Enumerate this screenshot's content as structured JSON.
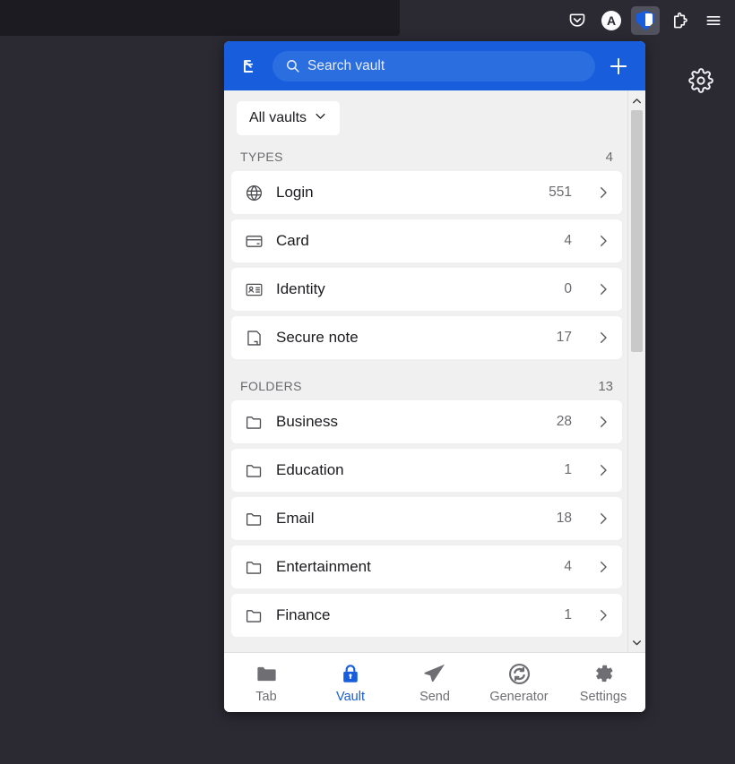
{
  "browser": {
    "toolbar_icons": [
      {
        "name": "pocket-icon",
        "label": "Pocket"
      },
      {
        "name": "account-avatar",
        "label": "A"
      },
      {
        "name": "bitwarden-extension-icon",
        "label": "Bitwarden"
      },
      {
        "name": "extensions-icon",
        "label": "Extensions"
      },
      {
        "name": "app-menu-icon",
        "label": "Open application menu"
      }
    ],
    "page_gear_label": "Settings"
  },
  "popup": {
    "header": {
      "popout_label": "Pop out to new window",
      "search_placeholder": "Search vault",
      "search_value": "",
      "add_label": "Add item"
    },
    "vault_filter": {
      "label": "All vaults"
    },
    "sections": [
      {
        "title": "TYPES",
        "count": "4",
        "rows": [
          {
            "icon": "globe-icon",
            "label": "Login",
            "count": "551"
          },
          {
            "icon": "credit-card-icon",
            "label": "Card",
            "count": "4"
          },
          {
            "icon": "id-card-icon",
            "label": "Identity",
            "count": "0"
          },
          {
            "icon": "note-icon",
            "label": "Secure note",
            "count": "17"
          }
        ]
      },
      {
        "title": "FOLDERS",
        "count": "13",
        "rows": [
          {
            "icon": "folder-icon",
            "label": "Business",
            "count": "28"
          },
          {
            "icon": "folder-icon",
            "label": "Education",
            "count": "1"
          },
          {
            "icon": "folder-icon",
            "label": "Email",
            "count": "18"
          },
          {
            "icon": "folder-icon",
            "label": "Entertainment",
            "count": "4"
          },
          {
            "icon": "folder-icon",
            "label": "Finance",
            "count": "1"
          }
        ]
      }
    ],
    "nav": [
      {
        "icon": "folder-icon",
        "label": "Tab",
        "active": false
      },
      {
        "icon": "lock-icon",
        "label": "Vault",
        "active": true
      },
      {
        "icon": "send-icon",
        "label": "Send",
        "active": false
      },
      {
        "icon": "refresh-icon",
        "label": "Generator",
        "active": false
      },
      {
        "icon": "gear-icon",
        "label": "Settings",
        "active": false
      }
    ]
  },
  "colors": {
    "brand_blue": "#175ddc",
    "page_dark": "#2b2a33",
    "urlbar_dark": "#1c1b22",
    "panel_bg": "#f0f0f0",
    "row_bg": "#ffffff"
  }
}
